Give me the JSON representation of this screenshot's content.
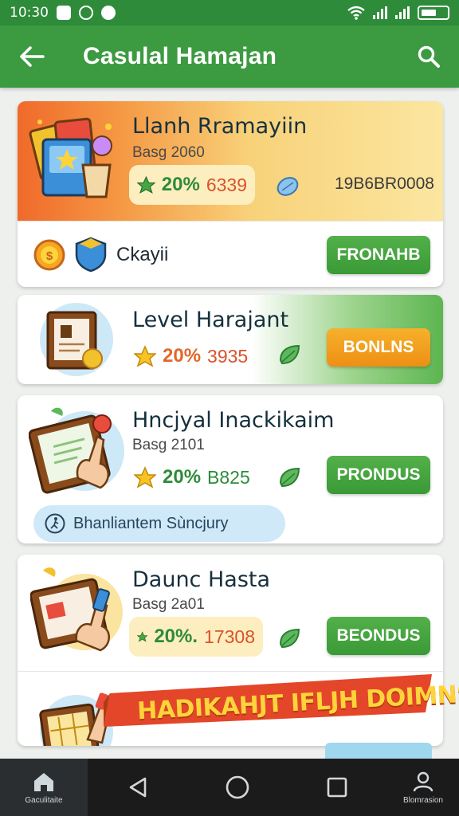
{
  "status_bar": {
    "time": "10:30"
  },
  "app_bar": {
    "title": "Casulal Hamajan"
  },
  "cards": [
    {
      "title": "Llanh Rramayiin",
      "subtitle": "Basg 2060",
      "percent": "20%",
      "number": "6339",
      "code": "19B6BR0008",
      "footer_label": "Ckayii",
      "button": "FRONAHB"
    },
    {
      "title": "Level Harajant",
      "percent": "20%",
      "number": "3935",
      "button": "BONLNS"
    },
    {
      "title": "Hncjyal Inackikaim",
      "subtitle": "Basg 2101",
      "percent": "20%",
      "number": "B825",
      "button": "PRONDUS",
      "info": "Bhanliantem Sùncjury"
    },
    {
      "title": "Daunc Hasta",
      "subtitle": "Basg 2a01",
      "percent": "20%.",
      "number": "17308",
      "button": "BEONDUS"
    }
  ],
  "banner": {
    "text": "HADIKAHJT IFLJH DOIMNS."
  },
  "nav": {
    "home_label": "Gaculitaite",
    "profile_label": "Blomrasion"
  },
  "colors": {
    "primary": "#3c9a41",
    "accent_orange": "#ee8f14",
    "banner_red": "#e4462a"
  }
}
